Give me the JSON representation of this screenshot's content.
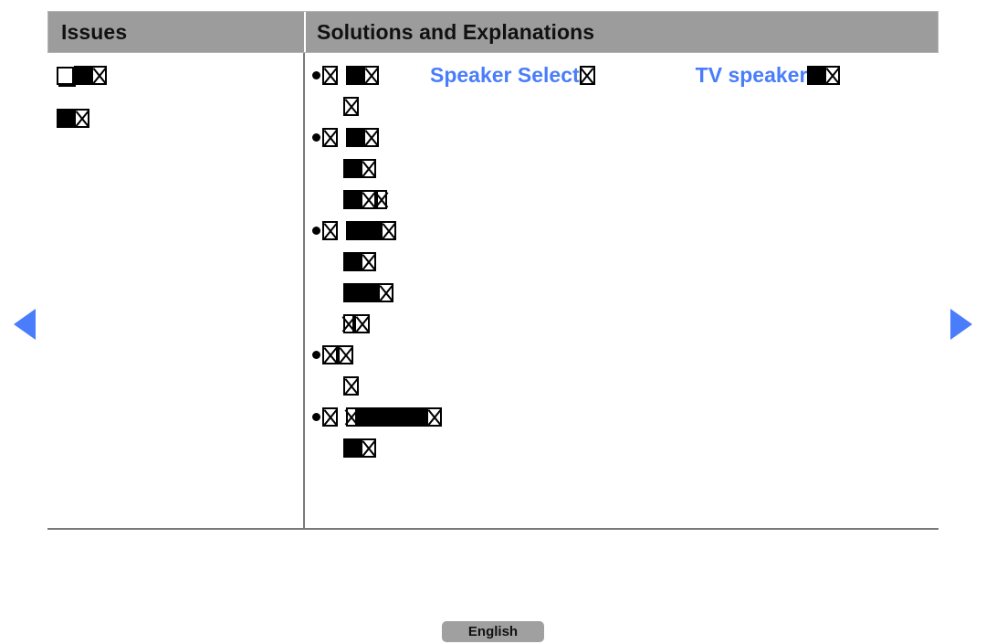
{
  "table": {
    "headers": {
      "issues": "Issues",
      "solutions": "Solutions and Explanations"
    },
    "issues_cell": {
      "lines": [
        {
          "glyphs": [
            "hollow",
            "solid",
            "xbox"
          ]
        },
        {
          "glyphs": [
            "solid",
            "xbox"
          ]
        }
      ]
    },
    "solutions_cell": {
      "groups": [
        {
          "lines": [
            {
              "bullet": true,
              "glyphs": [
                "xbox",
                "space",
                "solid",
                "xbox"
              ],
              "links": [
                {
                  "text": "Speaker Select",
                  "trailing": [
                    "xbox"
                  ]
                },
                {
                  "text": "TV speaker",
                  "trailing": [
                    "solid",
                    "xbox"
                  ]
                }
              ]
            },
            {
              "indent": true,
              "glyphs": [
                "xbox"
              ]
            }
          ]
        },
        {
          "lines": [
            {
              "bullet": true,
              "glyphs": [
                "xbox",
                "space",
                "solid",
                "xbox"
              ]
            },
            {
              "indent": true,
              "glyphs": [
                "solid",
                "xbox"
              ]
            },
            {
              "indent": true,
              "glyphs": [
                "solid",
                "xbox",
                "xbox-slim"
              ]
            }
          ]
        },
        {
          "lines": [
            {
              "bullet": true,
              "glyphs": [
                "xbox",
                "space",
                "solid",
                "solid",
                "xbox"
              ]
            },
            {
              "indent": true,
              "glyphs": [
                "solid",
                "xbox"
              ]
            },
            {
              "indent": true,
              "glyphs": [
                "solid",
                "solid",
                "xbox"
              ]
            },
            {
              "indent": true,
              "glyphs": [
                "xbox-slim",
                "xbox"
              ]
            }
          ]
        },
        {
          "lines": [
            {
              "bullet": true,
              "glyphs": [
                "xbox",
                "xbox"
              ]
            },
            {
              "indent": true,
              "glyphs": [
                "xbox"
              ]
            }
          ]
        },
        {
          "lines": [
            {
              "bullet": true,
              "glyphs": [
                "xbox",
                "space",
                "xbox-slim",
                "solid",
                "solid",
                "solid",
                "solid",
                "xbox"
              ]
            },
            {
              "indent": true,
              "glyphs": [
                "solid",
                "xbox"
              ]
            }
          ]
        }
      ]
    }
  },
  "nav": {
    "prev_label": "previous-page",
    "next_label": "next-page",
    "arrow_color": "#4a7dfb"
  },
  "footer": {
    "language_label": "English"
  },
  "colors": {
    "header_background": "#9c9c9c",
    "link_blue": "#4a7dfb",
    "border_gray": "#7a7a7a",
    "button_gray": "#a0a0a0"
  }
}
